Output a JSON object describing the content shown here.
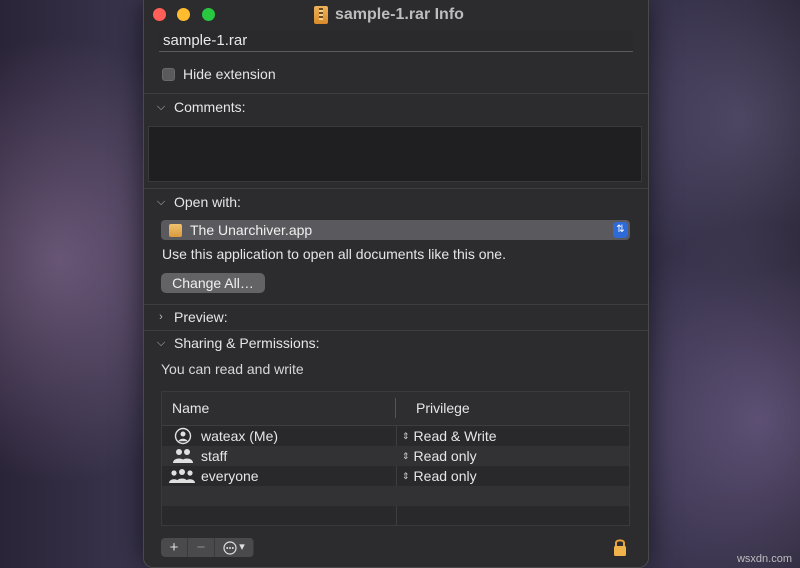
{
  "window": {
    "title": "sample-1.rar Info",
    "name_value": "sample-1.rar",
    "hide_extension_label": "Hide extension",
    "hide_extension_checked": false
  },
  "sections": {
    "comments": {
      "label": "Comments:",
      "expanded": true
    },
    "open_with": {
      "label": "Open with:",
      "expanded": true,
      "selected_app": "The Unarchiver.app",
      "description": "Use this application to open all documents like this one.",
      "change_all_label": "Change All…"
    },
    "preview": {
      "label": "Preview:",
      "expanded": false
    },
    "sharing": {
      "label": "Sharing & Permissions:",
      "expanded": true,
      "status_text": "You can read and write",
      "columns": {
        "name": "Name",
        "privilege": "Privilege"
      },
      "rows": [
        {
          "name": "wateax (Me)",
          "privilege": "Read & Write",
          "icon": "single-user-icon"
        },
        {
          "name": "staff",
          "privilege": "Read only",
          "icon": "group-icon"
        },
        {
          "name": "everyone",
          "privilege": "Read only",
          "icon": "everyone-icon"
        }
      ]
    }
  },
  "toolbar": {
    "add": "+",
    "remove": "−",
    "action_chevron": "⌄"
  },
  "watermark": "wsxdn.com"
}
